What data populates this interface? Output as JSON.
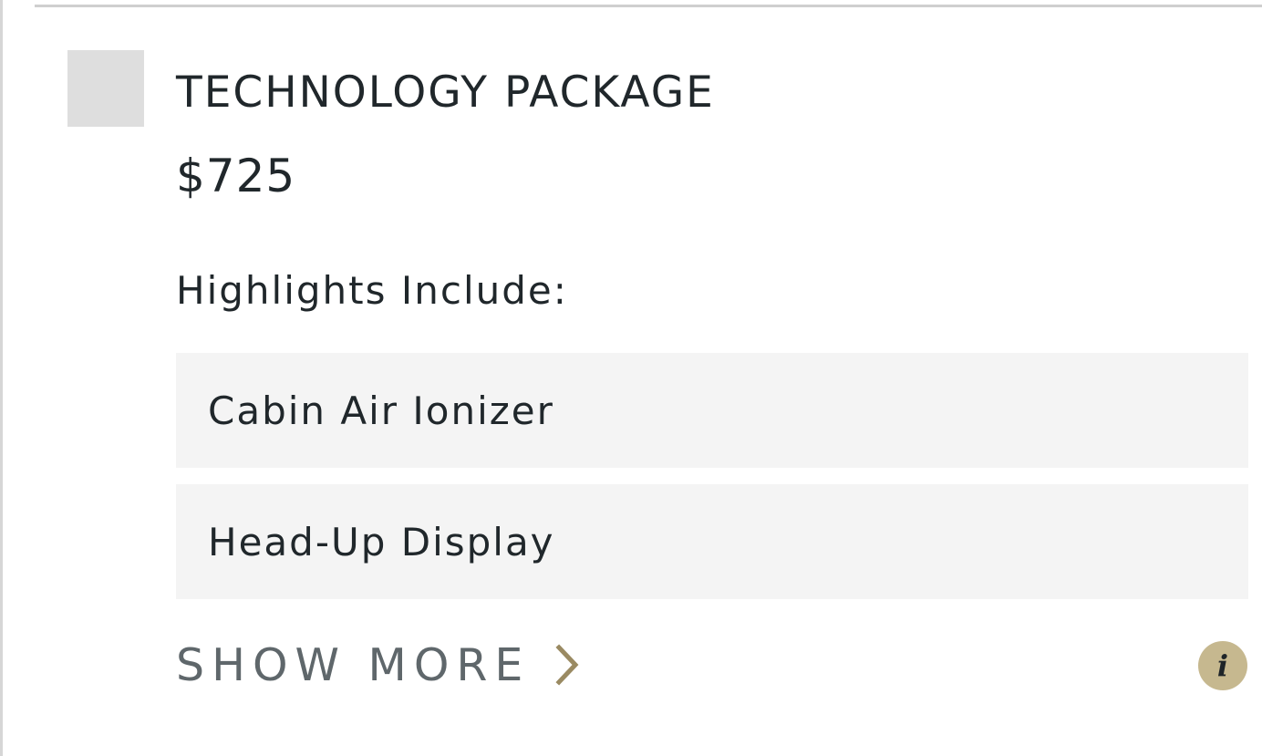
{
  "package": {
    "title": "TECHNOLOGY PACKAGE",
    "price": "$725",
    "highlights_label": "Highlights Include:",
    "features": [
      {
        "label": "Cabin Air Ionizer"
      },
      {
        "label": "Head-Up Display"
      }
    ],
    "show_more_label": "SHOW MORE",
    "info_glyph": "i"
  },
  "icons": {
    "show_more": "chevron-right-icon",
    "info": "info-icon"
  },
  "colors": {
    "text": "#20272b",
    "muted_text": "#5f676b",
    "accent": "#9a8a62",
    "info_bg": "#c6b88f",
    "feature_bg": "#f4f4f4",
    "checkbox_bg": "#dedede"
  }
}
